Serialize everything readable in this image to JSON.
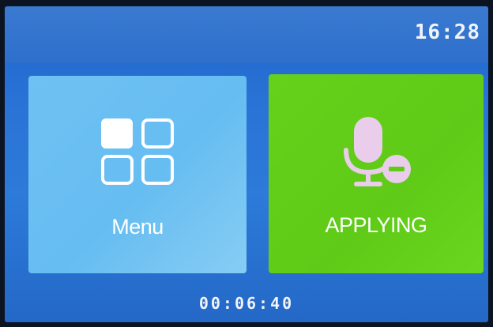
{
  "status": {
    "clock": "16:28"
  },
  "tiles": {
    "menu": {
      "label": "Menu",
      "icon": "grid-icon",
      "color": "#6fc1f3"
    },
    "applying": {
      "label": "APPLYING",
      "icon": "microphone-minus-icon",
      "color": "#62ce1a"
    }
  },
  "footer": {
    "timer": "00:06:40"
  }
}
